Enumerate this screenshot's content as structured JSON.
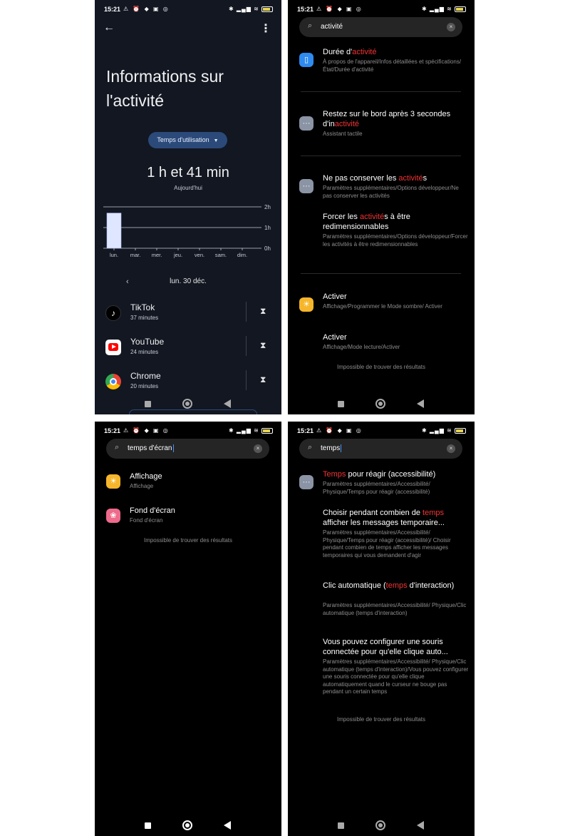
{
  "status": {
    "time": "15:21"
  },
  "panel1": {
    "title": "Informations sur l'activité",
    "dropdown": "Temps d'utilisation",
    "total": "1 h et 41 min",
    "total_caption": "Aujourd'hui",
    "chart_data": {
      "type": "bar",
      "categories": [
        "lun.",
        "mar.",
        "mer.",
        "jeu.",
        "ven.",
        "sam.",
        "dim."
      ],
      "values": [
        1.7,
        0,
        0,
        0,
        0,
        0,
        0
      ],
      "ylim": [
        0,
        2
      ],
      "y_ticks": [
        "2h",
        "1h",
        "0h"
      ],
      "grid": true,
      "bar_color": "#dfe6ff"
    },
    "date": "lun. 30 déc.",
    "apps": [
      {
        "name": "TikTok",
        "time": "37 minutes",
        "icon": "tiktok-icon"
      },
      {
        "name": "YouTube",
        "time": "24 minutes",
        "icon": "youtube-icon"
      },
      {
        "name": "Chrome",
        "time": "20 minutes",
        "icon": "chrome-icon"
      }
    ]
  },
  "panel2": {
    "query": "activité",
    "results": [
      {
        "title_pre": "Durée d'",
        "title_hl": "activité",
        "title_post": "",
        "sub": "À propos de l'appareil/Infos détaillées et spécifications/État/Durée d'activité",
        "icon": "device-icon"
      },
      {
        "title_pre": "Restez sur le bord après 3 secondes d'in",
        "title_hl": "activité",
        "title_post": "",
        "sub": "Assistant tactile",
        "icon": "more-dots-icon"
      },
      {
        "title_pre": "Ne pas conserver les ",
        "title_hl": "activité",
        "title_post": "s",
        "sub": "Paramètres supplémentaires/Options développeur/Ne pas conserver les activités",
        "icon": "more-dots-icon"
      },
      {
        "title_pre": "Forcer les ",
        "title_hl": "activité",
        "title_post": "s à être redimensionnables",
        "sub": "Paramètres supplémentaires/Options développeur/Forcer les activités à être redimensionnables",
        "icon": "none"
      },
      {
        "title_pre": "Activer",
        "title_hl": "",
        "title_post": "",
        "sub": "Affichage/Programmer le Mode sombre/ Activer",
        "icon": "sun-icon"
      },
      {
        "title_pre": "Activer",
        "title_hl": "",
        "title_post": "",
        "sub": "Affichage/Mode lecture/Activer",
        "icon": "none"
      }
    ],
    "no_results": "Impossible de trouver des résultats"
  },
  "panel3": {
    "query": "temps d'écran",
    "results": [
      {
        "title": "Affichage",
        "sub": "Affichage",
        "icon": "sun-icon"
      },
      {
        "title": "Fond d'écran",
        "sub": "Fond d'écran",
        "icon": "flower-icon"
      }
    ],
    "no_results": "Impossible de trouver des résultats"
  },
  "panel4": {
    "query": "temps",
    "results": [
      {
        "title_pre": "",
        "title_hl": "Temps",
        "title_post": " pour réagir (accessibilité)",
        "sub": "Paramètres supplémentaires/Accessibilité/ Physique/Temps pour réagir (accessibilité)",
        "icon": "more-dots-icon"
      },
      {
        "title_pre": "Choisir pendant combien de ",
        "title_hl": "temps",
        "title_post": " afficher les messages temporaire...",
        "sub": "Paramètres supplémentaires/Accessibilité/ Physique/Temps pour réagir (accessibilité)/ Choisir pendant combien de temps afficher les messages temporaires qui vous demandent d'agir",
        "icon": "none"
      },
      {
        "title_pre": "Clic automatique (",
        "title_hl": "temps",
        "title_post": " d'interaction)",
        "sub": "Paramètres supplémentaires/Accessibilité/ Physique/Clic automatique (temps d'interaction)",
        "icon": "none"
      },
      {
        "title_pre": "Vous pouvez configurer une souris connectée pour qu'elle clique auto...",
        "title_hl": "",
        "title_post": "",
        "sub": "Paramètres supplémentaires/Accessibilité/ Physique/Clic automatique (temps d'interaction)/Vous pouvez configurer une souris connectée pour qu'elle clique automatiquement quand le curseur ne bouge pas pendant un certain temps",
        "icon": "none"
      }
    ],
    "no_results": "Impossible de trouver des résultats"
  }
}
